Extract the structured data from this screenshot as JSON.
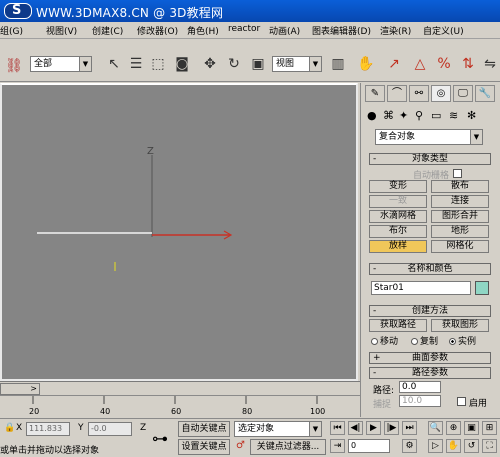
{
  "title_bar": {
    "logo_text": "S",
    "title": "WWW.3DMAX8.CN @ 3D教程网"
  },
  "menu": [
    "组(G)",
    "视图(V)",
    "创建(C)",
    "修改器(O)",
    "角色(H)",
    "reactor",
    "动画(A)",
    "图表编辑器(D)",
    "渲染(R)",
    "自定义(U)"
  ],
  "toolbar": {
    "selection_filter": "全部",
    "reference_coord": "视图"
  },
  "viewport": {
    "axis_z_label": "Z"
  },
  "time_slider": {
    "frame_text": ">",
    "ruler_ticks": [
      "20",
      "40",
      "60",
      "80",
      "100"
    ]
  },
  "status": {
    "x_label": "X",
    "x_value": "111.833",
    "y_label": "Y",
    "y_value": "-0.0",
    "z_label": "Z",
    "prompt": "或单击并拖动以选择对象",
    "auto_key": "自动关键点",
    "set_key": "设置关键点",
    "selected_dropdown": "选定对象",
    "key_filters": "关键点过滤器...",
    "frame_value": "0"
  },
  "command_panel": {
    "category_dropdown": "复合对象",
    "object_type": {
      "header": "对象类型",
      "autogrid_label": "自动栅格",
      "buttons": [
        "变形",
        "散布",
        "一致",
        "连接",
        "水滴网格",
        "图形合并",
        "布尔",
        "地形",
        "放样",
        "网格化"
      ]
    },
    "name_color": {
      "header": "名称和颜色",
      "name_value": "Star01"
    },
    "creation_method": {
      "header": "创建方法",
      "get_path": "获取路径",
      "get_shape": "获取图形",
      "move": "移动",
      "copy": "复制",
      "instance": "实例"
    },
    "surface_params": {
      "header": "曲面参数"
    },
    "path_params": {
      "header": "路径参数",
      "path_label": "路径:",
      "path_value": "0.0",
      "snap_label": "捕捉",
      "snap_value": "10.0",
      "enable_label": "启用"
    }
  },
  "colors": {
    "titlebar": "#0a5fd8",
    "viewport_bg": "#858585",
    "active_button": "#f0c75a",
    "swatch": "#8fd6c4"
  }
}
